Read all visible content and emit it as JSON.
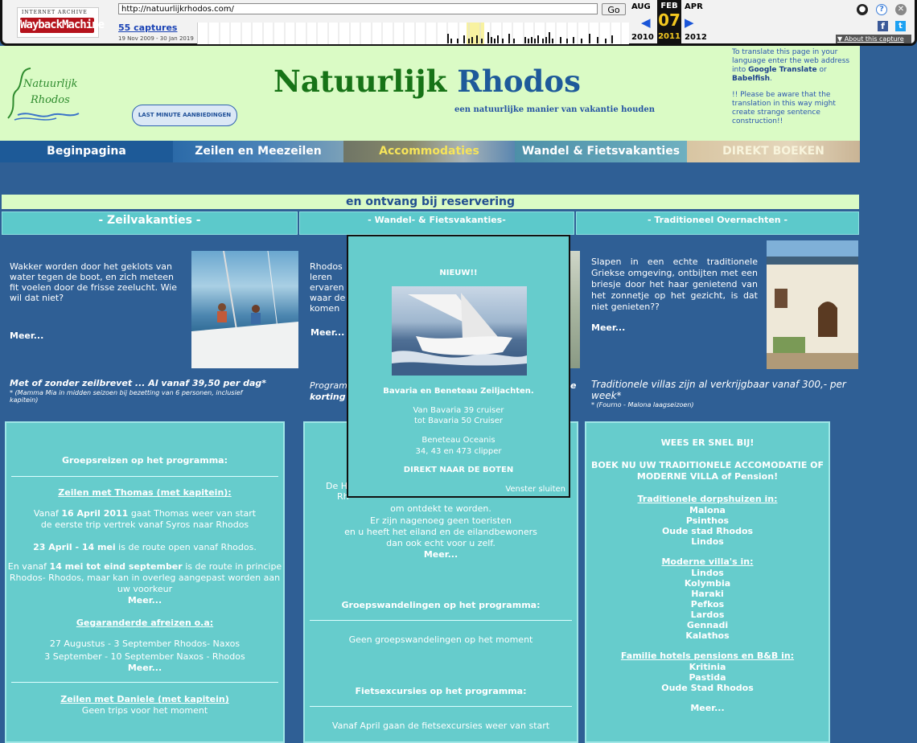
{
  "wayback": {
    "logo_top": "INTERNET ARCHIVE",
    "logo_main": "WaybackMachine",
    "url": "http://natuurlijkrhodos.com/",
    "go": "Go",
    "captures": "55 captures",
    "range": "19 Nov 2009 - 30 Jan 2019",
    "prev_month": "AUG",
    "cur_month": "FEB",
    "next_month": "APR",
    "day": "07",
    "prev_year": "2010",
    "cur_year": "2011",
    "next_year": "2012",
    "about": "▼ About this capture"
  },
  "header": {
    "logo_line1": "Natuurlijk",
    "logo_line2": "Rhodos",
    "title_a": "Natuurlijk",
    "title_b": "Rhodos",
    "subtitle": "een natuurlijke manier van vakantie houden",
    "last_minute": "LAST MINUTE AANBIEDINGEN",
    "translate_1": "To translate this page in your language enter the web address into ",
    "translate_google": "Google Translate",
    "translate_or": " or ",
    "translate_babel": "Babelfish",
    "translate_dot": ".",
    "translate_2": "!! Please be aware that the translation in this way might create strange sentence construction!!"
  },
  "nav": [
    "Beginpagina",
    "Zeilen en Meezeilen",
    "Accommodaties",
    "Wandel & Fietsvakanties",
    "DIREKT BOEKEN"
  ],
  "ribbon": "en ontvang bij reservering",
  "columns": {
    "head1": "- Zeilvakanties -",
    "head2": "- Wandel- & Fietsvakanties-",
    "head3": "- Traditioneel Overnachten -",
    "c1_text": "Wakker worden door het geklots van water tegen de boot, en zich meteen fit voelen door de frisse zeelucht. Wie wil dat niet?",
    "c1_meer": "Meer...",
    "c1_promo": "Met of zonder zeilbrevet ... Al vanaf 39,50 per dag*",
    "c1_fine": "* (Mamma Mia in midden seizoen bij bezetting van 6 personen, inclusief kapitein)",
    "c2_text": "Rhodos leren ervaren waar de komen",
    "c2_meer": "Meer...",
    "c2_promo_a": "Program",
    "c2_promo_b": "korting",
    "c2_promo_c": "e",
    "c3_text": "Slapen in een echte traditionele Griekse omgeving, ontbijten met een briesje door het haar genietend van het zonnetje op het gezicht, is dat niet genieten??",
    "c3_meer": "Meer...",
    "c3_promo": "Traditionele villas zijn al verkrijgbaar vanaf 300,- per week*",
    "c3_fine": "* (Fourno - Malona laagseizoen)"
  },
  "box1": {
    "title": "Groepsreizen op het programma:",
    "link1": "Zeilen met Thomas (met kapitein):",
    "p1a": "Vanaf ",
    "p1b": "16 April 2011",
    "p1c": " gaat Thomas weer van start",
    "p1d": "de eerste trip vertrek vanaf Syros naar Rhodos",
    "p2a": "23 April - 14 mei",
    "p2b": " is de route open vanaf Rhodos.",
    "p3a": "En vanaf ",
    "p3b": "14 mei tot eind september",
    "p3c": " is de route in principe Rhodos- Rhodos, maar kan in overleg aangepast worden aan uw voorkeur",
    "meer1": "Meer...",
    "link2": "Gegaranderde afreizen o.a:",
    "trip1": "27 Augustus - 3 September Rhodos- Naxos",
    "trip2": "3 September - 10 September Naxos - Rhodos",
    "meer2": "Meer...",
    "link3": "Zeilen met Daniele (met kapitein)",
    "none": "Geen trips voor het moment"
  },
  "box2": {
    "p_a": "De H",
    "p_b": "Rh",
    "p_c": "om ontdekt te worden.",
    "p_d": "Er zijn nagenoeg geen toeristen",
    "p_e": "en u heeft het eiland en de eilandbewoners",
    "p_f": "dan ook echt voor u zelf.",
    "meer": "Meer...",
    "h2": "Groepswandelingen op het programma:",
    "none": "Geen groepswandelingen op het moment",
    "h3": "Fietsexcursies op het programma:",
    "bike": "Vanaf April gaan de fietsexcursies weer van start"
  },
  "box3": {
    "h1": "WEES ER SNEL BIJ!",
    "h2": "BOEK NU UW TRADITIONELE ACCOMODATIE OF MODERNE VILLA of Pension!",
    "l1": "Traditionele dorpshuizen in:",
    "v1": [
      "Malona",
      "Psinthos",
      "Oude stad Rhodos",
      "Lindos"
    ],
    "l2": "Moderne villa's in:",
    "v2": [
      "Lindos",
      "Kolymbia",
      "Haraki",
      "Pefkos",
      "Lardos",
      "Gennadi",
      "Kalathos"
    ],
    "l3": "Familie hotels pensions en B&B in:",
    "v3": [
      "Kritinia",
      "Pastida",
      "Oude Stad Rhodos"
    ],
    "meer": "Meer..."
  },
  "popup": {
    "nieuw": "NIEUW!!",
    "title": "Bavaria en Beneteau Zeiljachten.",
    "l1": "Van Bavaria 39 cruiser",
    "l2": "tot Bavaria 50 Cruiser",
    "l3": "Beneteau Oceanis",
    "l4": "34, 43 en 473 clipper",
    "direkt": "DIREKT NAAR DE BOTEN",
    "close": "Venster sluiten"
  }
}
